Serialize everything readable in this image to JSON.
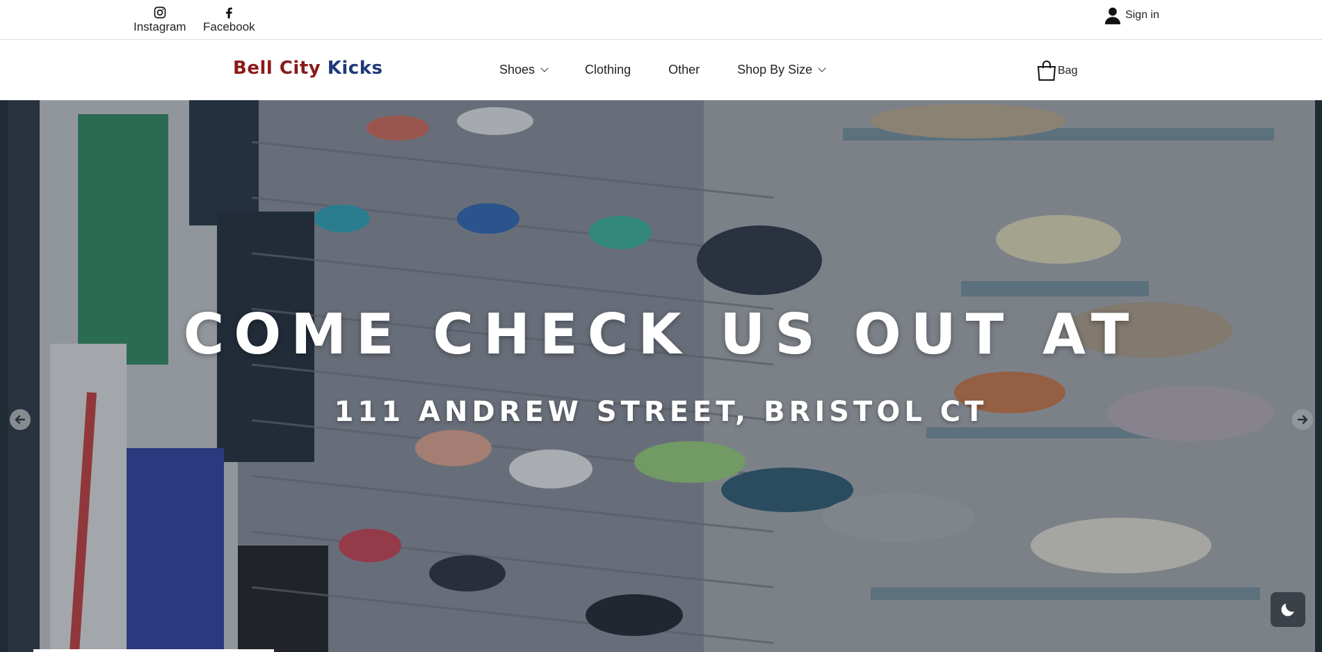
{
  "topbar": {
    "social": [
      {
        "label": "Instagram",
        "icon": "instagram-icon"
      },
      {
        "label": "Facebook",
        "icon": "facebook-icon"
      }
    ],
    "signin_label": "Sign in"
  },
  "brand": {
    "logo_part1": "Bell City ",
    "logo_part2": "Kicks",
    "colors": {
      "part1": "#8b1a1a",
      "part2": "#1e3a7b"
    }
  },
  "nav": {
    "items": [
      {
        "label": "Shoes",
        "has_dropdown": true
      },
      {
        "label": "Clothing",
        "has_dropdown": false
      },
      {
        "label": "Other",
        "has_dropdown": false
      },
      {
        "label": "Shop By Size",
        "has_dropdown": true
      }
    ],
    "bag_label": "Bag"
  },
  "hero": {
    "headline": "COME CHECK US OUT AT",
    "address": "111 ANDREW STREET, BRISTOL CT",
    "slide_progress": 0.19
  }
}
